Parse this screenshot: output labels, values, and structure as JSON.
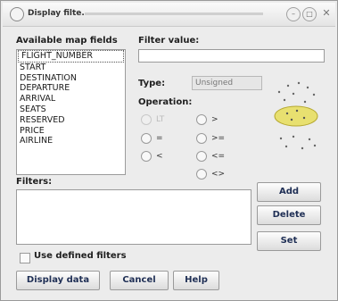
{
  "window": {
    "title": "Display filte..."
  },
  "fields": {
    "label": "Available map fields",
    "items": [
      "FLIGHT_NUMBER",
      "START",
      "DESTINATION",
      "DEPARTURE",
      "ARRIVAL",
      "SEATS",
      "RESERVED",
      "PRICE",
      "AIRLINE"
    ]
  },
  "filter_value": {
    "label": "Filter value:",
    "value": ""
  },
  "type": {
    "label": "Type:",
    "value": "Unsigned"
  },
  "operation": {
    "label": "Operation:",
    "options_left": [
      "LT",
      "=",
      "<"
    ],
    "options_right": [
      ">",
      ">=",
      "<=",
      "<>"
    ]
  },
  "filters": {
    "label": "Filters:",
    "use_defined_label": "Use defined filters"
  },
  "buttons": {
    "add": "Add",
    "delete": "Delete",
    "set": "Set",
    "display_data": "Display data",
    "cancel": "Cancel",
    "help": "Help"
  }
}
